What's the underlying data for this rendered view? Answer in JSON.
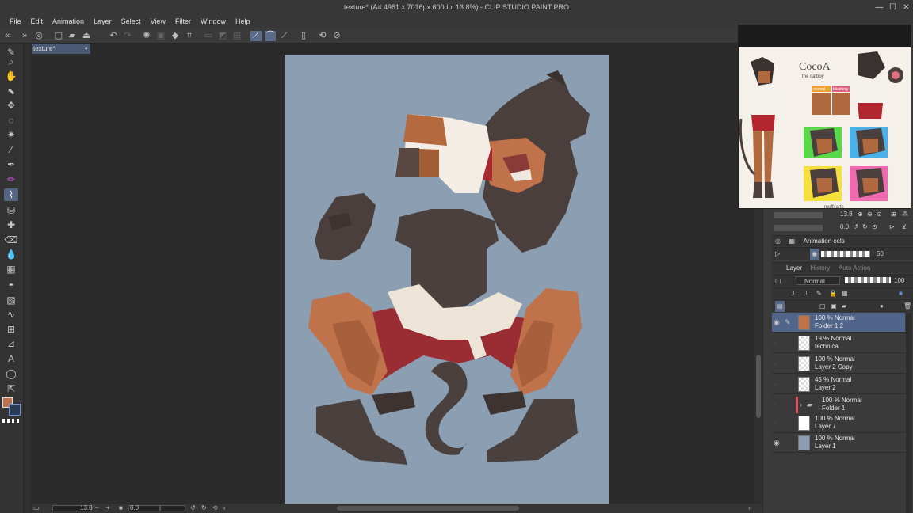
{
  "window": {
    "title": "texture* (A4 4961 x 7016px 600dpi 13.8%)  - CLIP STUDIO PAINT PRO",
    "minimize": "—",
    "maximize": "☐",
    "close": "✕"
  },
  "menu": [
    "File",
    "Edit",
    "Animation",
    "Layer",
    "Select",
    "View",
    "Filter",
    "Window",
    "Help"
  ],
  "document_tab": {
    "label": "texture*",
    "close": "•"
  },
  "navigator": {
    "zoom": "13.8",
    "rotation": "0.0"
  },
  "animation_panel": {
    "tab_label": "Animation cels",
    "opacity_value": "50"
  },
  "layer_panel": {
    "tabs": [
      "Layer",
      "History",
      "Auto Action"
    ],
    "blend_mode": "Normal",
    "opacity": "100",
    "layers": [
      {
        "opacity_mode": "100 % Normal",
        "name": "Folder 1 2",
        "selected": true,
        "visible": true
      },
      {
        "opacity_mode": "19 % Normal",
        "name": "technical",
        "selected": false,
        "visible": false
      },
      {
        "opacity_mode": "100 % Normal",
        "name": "Layer 2 Copy",
        "selected": false,
        "visible": false
      },
      {
        "opacity_mode": "45 % Normal",
        "name": "Layer 2",
        "selected": false,
        "visible": false
      },
      {
        "opacity_mode": "100 % Normal",
        "name": "Folder 1",
        "selected": false,
        "visible": false,
        "folder": true
      },
      {
        "opacity_mode": "100 % Normal",
        "name": "Layer 7",
        "selected": false,
        "visible": false
      },
      {
        "opacity_mode": "100 % Normal",
        "name": "Layer 1",
        "selected": false,
        "visible": true
      }
    ]
  },
  "bottom": {
    "zoom": "13.8",
    "angle": "0.0"
  },
  "reference": {
    "title": "CocoA",
    "subtitle": "the catboy",
    "label_normal": "normal",
    "label_blush": "blushing",
    "signature": "moffvarts"
  },
  "colors": {
    "canvas_bg": "#8b9eb2",
    "main_color": "#c0724a",
    "sub_color": "#3b5fa0",
    "selected_layer": "#51648a"
  }
}
